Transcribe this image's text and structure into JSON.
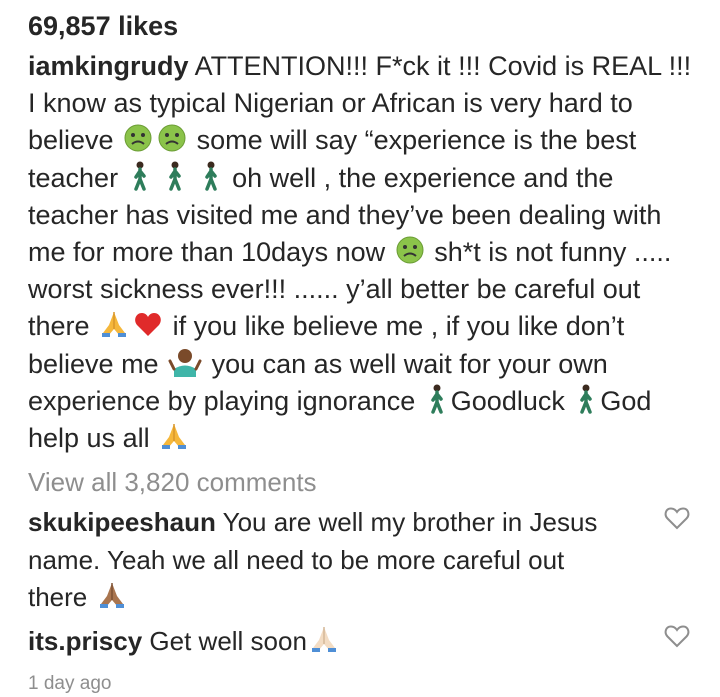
{
  "post": {
    "likes": "69,857 likes",
    "author": "iamkingrudy",
    "caption_lines": [
      "ATTENTION!!! F*ck it !!! Covid is REAL !!!",
      "I know as typical Nigerian or African is very hard to",
      "believe",
      "some will say “experience is the best",
      "teacher",
      "oh well , the experience and the",
      "teacher has visited me and they’ve  been dealing with",
      "me for more than 10days now",
      "sh*t is not funny .....",
      "worst sickness ever!!! ...... y’all better be careful out",
      "there",
      "if you like believe me , if you like don’t",
      "believe me",
      "you can as well wait for your own",
      "experience by playing ignorance",
      "Goodluck",
      "God",
      "help us all"
    ],
    "icons": {
      "sick_face": "nauseated-face-icon",
      "walking": "person-walking-icon",
      "praying": "folded-hands-icon",
      "heart": "red-heart-icon",
      "shrug": "person-shrugging-icon"
    }
  },
  "view_all_comments": "View all 3,820 comments",
  "comments": [
    {
      "username": "skukipeeshaun",
      "lines": [
        "You are well my brother in Jesus",
        "name. Yeah we all need to be more careful out",
        "there"
      ]
    },
    {
      "username": "its.priscy",
      "text": "Get well soon"
    }
  ],
  "timestamp": "1 day ago"
}
